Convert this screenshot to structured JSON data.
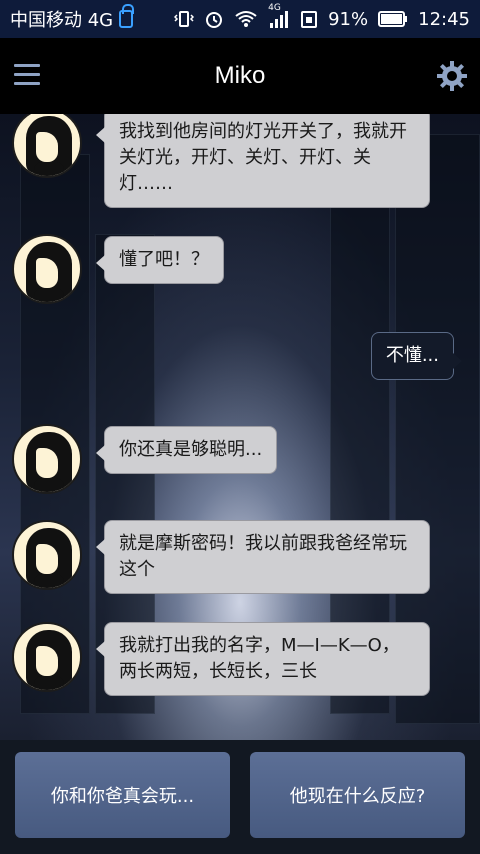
{
  "status_bar": {
    "carrier": "中国移动 4G",
    "battery": "91%",
    "time": "12:45",
    "network_small": "4G"
  },
  "app_bar": {
    "title": "Miko",
    "menu_icon": "hamburger-menu-icon",
    "settings_icon": "gear-icon"
  },
  "messages": [
    {
      "sender": "miko",
      "text": "我找到他房间的灯光开关了，我就开关灯光，开灯、关灯、开灯、关灯……"
    },
    {
      "sender": "miko",
      "text": "懂了吧！？"
    },
    {
      "sender": "user",
      "text": "不懂..."
    },
    {
      "sender": "miko",
      "text": "你还真是够聪明..."
    },
    {
      "sender": "miko",
      "text": "就是摩斯密码！我以前跟我爸经常玩这个"
    },
    {
      "sender": "miko",
      "text": "我就打出我的名字，M—I—K—O，两长两短，长短长，三长"
    }
  ],
  "choices": [
    {
      "label": "你和你爸真会玩..."
    },
    {
      "label": "他现在什么反应?"
    }
  ],
  "colors": {
    "status_bar_bg": "#0e1b3a",
    "app_bar_bg": "#000000",
    "bubble_left_bg": "#cfcfd2",
    "bubble_right_bg": "#131a29",
    "choice_bg": "#5c6f96"
  }
}
